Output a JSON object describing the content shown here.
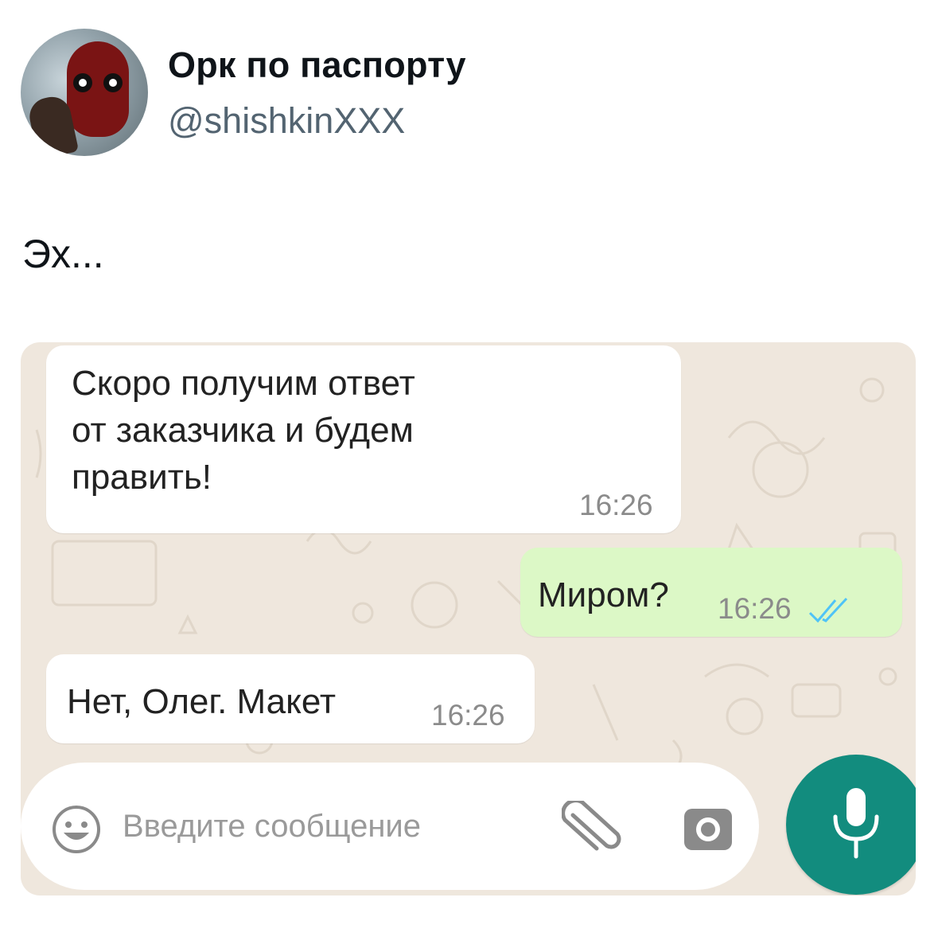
{
  "user": {
    "name": "Орк по паспорту",
    "handle": "@shishkinXXX"
  },
  "tweet": {
    "text": "Эх..."
  },
  "chat": {
    "messages": [
      {
        "direction": "incoming",
        "lines": [
          "Скоро получим ответ",
          "от заказчика и будем",
          "править!"
        ],
        "time": "16:26"
      },
      {
        "direction": "outgoing",
        "text": "Миром?",
        "time": "16:26",
        "status": "read"
      },
      {
        "direction": "incoming",
        "text": "Нет, Олег. Макет",
        "time": "16:26"
      }
    ],
    "input": {
      "placeholder": "Введите сообщение"
    },
    "icons": {
      "emoji": "emoji-icon",
      "attach": "paperclip-icon",
      "camera": "camera-icon",
      "mic": "microphone-icon",
      "read_ticks": "double-check-icon"
    },
    "colors": {
      "background": "#efe7dd",
      "incoming_bubble": "#ffffff",
      "outgoing_bubble": "#dcf8c6",
      "mic_button": "#128c7e",
      "read_ticks": "#4fc3f7"
    }
  }
}
